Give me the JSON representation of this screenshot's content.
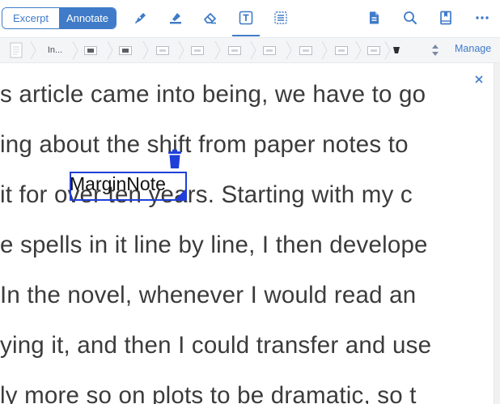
{
  "toolbar": {
    "excerpt_label": "Excerpt",
    "annotate_label": "Annotate",
    "accent": "#3f7bc8",
    "tools": [
      "pen-icon",
      "highlighter-icon",
      "eraser-icon",
      "textbox-icon",
      "list-icon"
    ],
    "right_tools": [
      "document-icon",
      "search-icon",
      "book-icon",
      "more-icon"
    ]
  },
  "tabs": {
    "items": [
      {
        "label": ""
      },
      {
        "label": "In..."
      },
      {
        "label": ""
      },
      {
        "label": ""
      },
      {
        "label": ""
      },
      {
        "label": ""
      },
      {
        "label": ""
      },
      {
        "label": ""
      },
      {
        "label": ""
      },
      {
        "label": ""
      },
      {
        "label": ""
      }
    ],
    "manage_label": "Manage"
  },
  "document": {
    "lines": [
      "s article came into being, we have to go",
      "ing about the shift from paper notes to",
      "it for over ten years. Starting with my c",
      "e spells in it line by line, I then develope",
      " In the novel, whenever I would read an",
      "ying it, and then I could transfer and use",
      "ly more so on plots to be dramatic, so t"
    ],
    "text_color": "#3b3b3b"
  },
  "margin_note": {
    "text": "MarginNote",
    "border_color": "#1f3fd8"
  }
}
